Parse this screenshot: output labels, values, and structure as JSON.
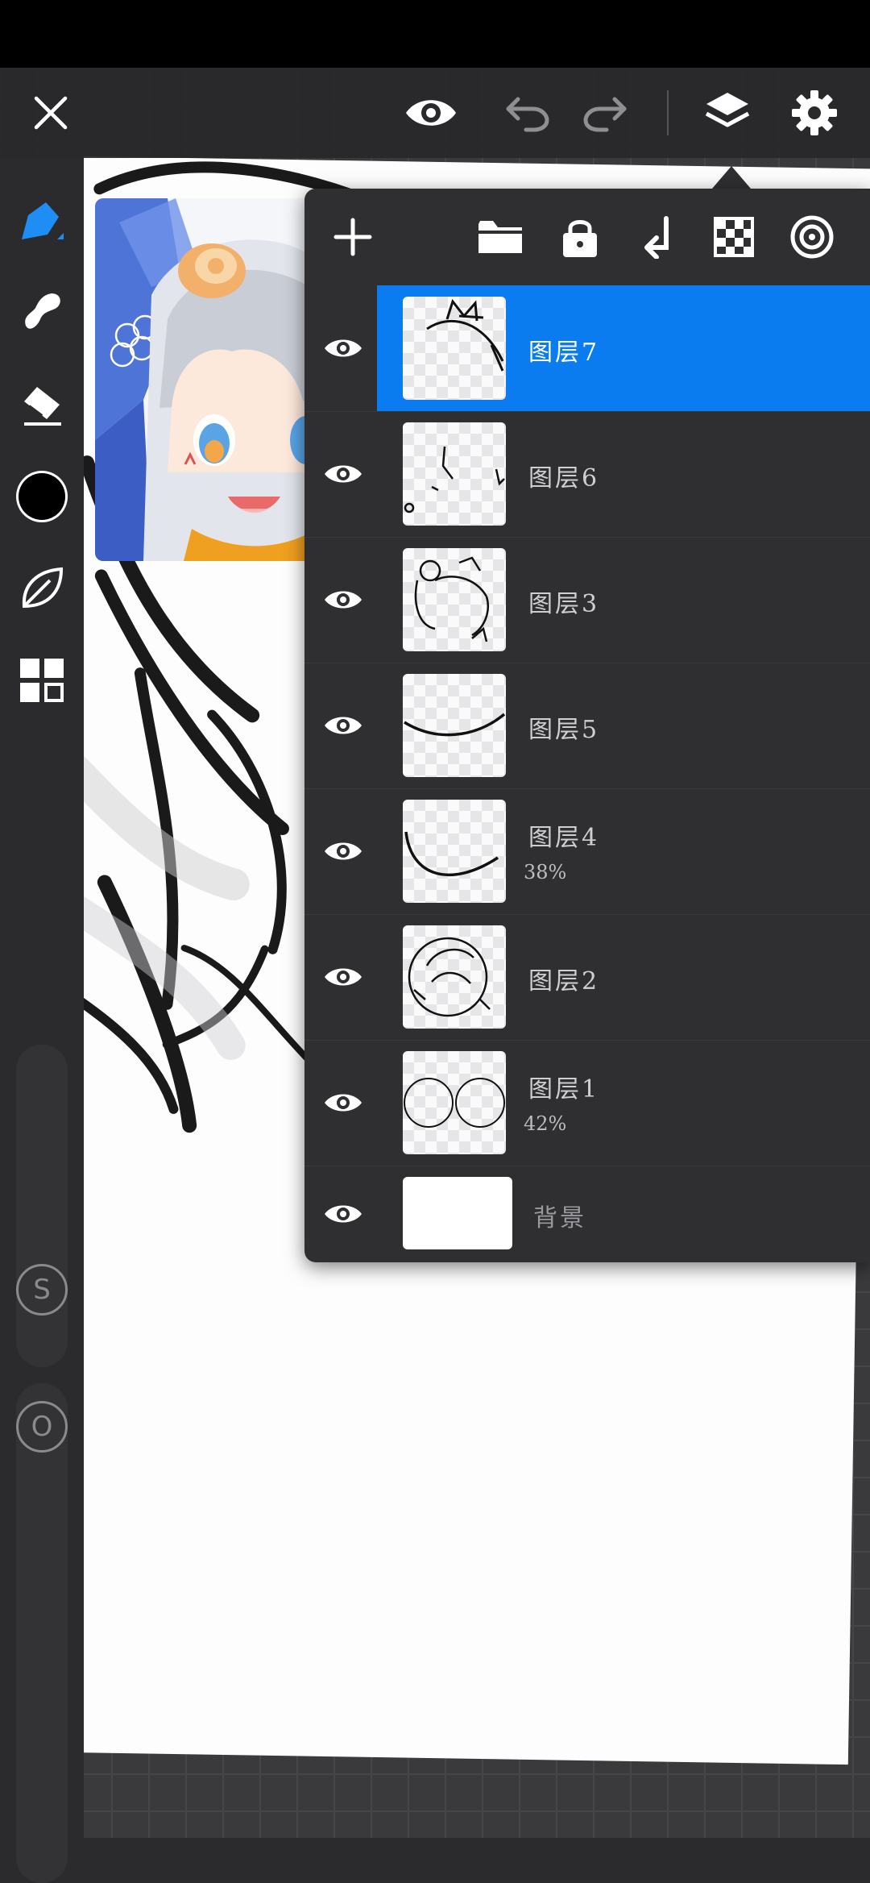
{
  "toolbar": {
    "close_icon": "close-icon",
    "preview_icon": "eye-icon",
    "undo_icon": "undo-icon",
    "redo_icon": "redo-icon",
    "layers_icon": "layers-icon",
    "settings_icon": "gear-icon"
  },
  "tools": [
    "pen-icon",
    "smudge-icon",
    "eraser-icon",
    "color-swatch",
    "leaf-icon",
    "grid-icon"
  ],
  "left_sliders": {
    "size_label": "S",
    "opacity_label": "O"
  },
  "layers_panel": {
    "toolbar_icons": [
      "plus-icon",
      "folder-icon",
      "lock-icon",
      "merge-down-icon",
      "checker-icon",
      "target-icon"
    ],
    "layers": [
      {
        "name": "图层7",
        "opacity": "",
        "selected": true
      },
      {
        "name": "图层6",
        "opacity": "",
        "selected": false
      },
      {
        "name": "图层3",
        "opacity": "",
        "selected": false
      },
      {
        "name": "图层5",
        "opacity": "",
        "selected": false
      },
      {
        "name": "图层4",
        "opacity": "38%",
        "selected": false
      },
      {
        "name": "图层2",
        "opacity": "",
        "selected": false
      },
      {
        "name": "图层1",
        "opacity": "42%",
        "selected": false
      }
    ],
    "background_layer": {
      "name": "背景"
    }
  },
  "colors": {
    "accent": "#0a7cf0",
    "panel": "#2f2f31",
    "current_color": "#000000"
  }
}
